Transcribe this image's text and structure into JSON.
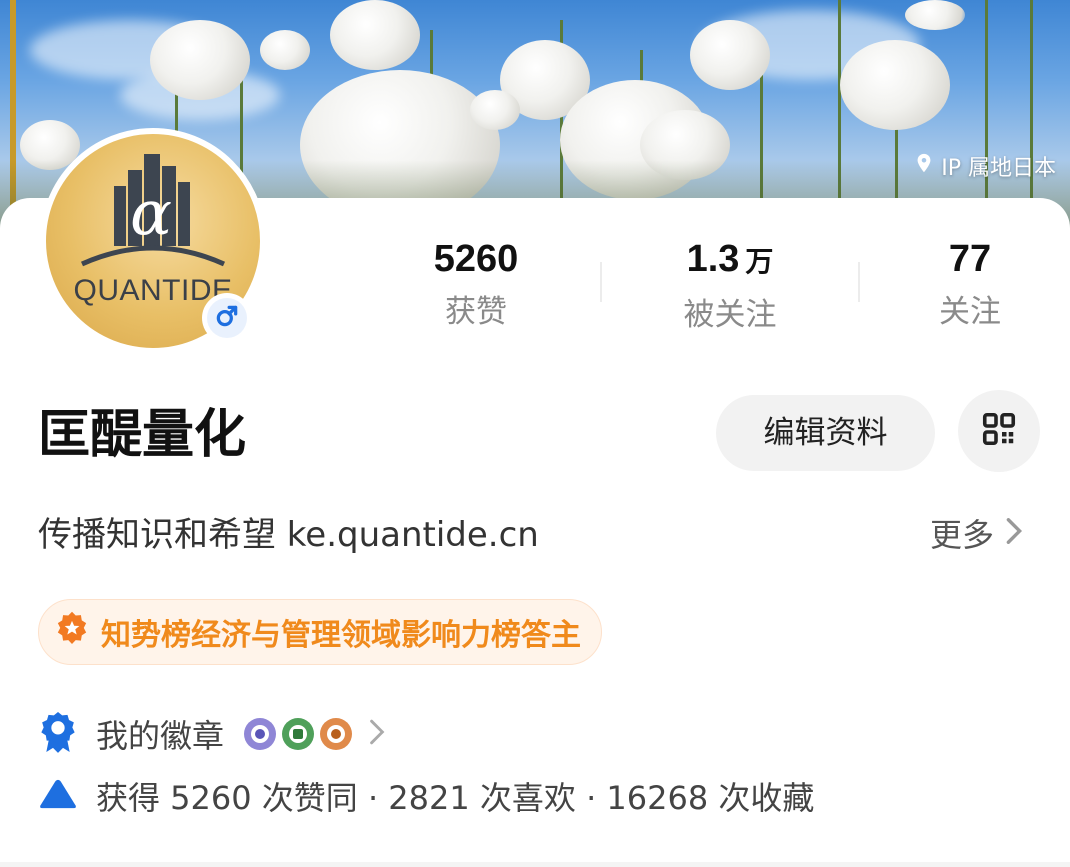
{
  "banner": {
    "ip_location": "IP 属地日本",
    "ip_icon": "location-pin-icon"
  },
  "profile": {
    "avatar_text": "QUANTIDE",
    "gender_icon": "male-icon",
    "gender_color": "#1e6fe0",
    "name": "匡醍量化",
    "bio": "传播知识和希望 ke.quantide.cn",
    "more_label": "更多"
  },
  "stats": [
    {
      "value": "5260",
      "unit": "",
      "label": "获赞"
    },
    {
      "value": "1.3",
      "unit": "万",
      "label": "被关注"
    },
    {
      "value": "77",
      "unit": "",
      "label": "关注"
    }
  ],
  "actions": {
    "edit_label": "编辑资料",
    "qr_icon": "qr-code-icon"
  },
  "honor": {
    "text": "知势榜经济与管理领域影响力榜答主",
    "icon": "star-badge-icon",
    "color": "#f08a1c"
  },
  "badges": {
    "label": "我的徽章",
    "icon": "ribbon-icon",
    "items": [
      {
        "name": "badge-1",
        "ring": "#8f86d6",
        "dot": "#5a55b8"
      },
      {
        "name": "badge-2",
        "ring": "#4fa05a",
        "dot": "#2f7a3a"
      },
      {
        "name": "badge-3",
        "ring": "#e08a4a",
        "dot": "#b8601e"
      }
    ]
  },
  "summary": {
    "text": "获得 5260 次赞同 · 2821 次喜欢 · 16268 次收藏",
    "icon": "upvote-triangle-icon",
    "accent": "#1e6fe0"
  }
}
